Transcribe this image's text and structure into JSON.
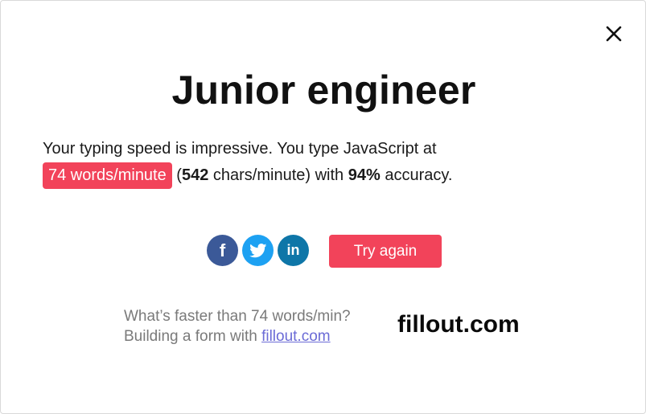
{
  "modal": {
    "title": "Junior engineer",
    "close_icon": "close-icon"
  },
  "result": {
    "intro": "Your typing speed is impressive. You type JavaScript at",
    "wpm_pill": "74 words/minute",
    "open_paren": " (",
    "chars": "542",
    "chars_suffix": " chars/minute) with ",
    "accuracy": "94%",
    "accuracy_suffix": " accuracy."
  },
  "share": {
    "facebook_glyph": "f",
    "linkedin_glyph": "in",
    "icons": [
      "facebook-icon",
      "twitter-icon",
      "linkedin-icon"
    ]
  },
  "actions": {
    "try_again_label": "Try again"
  },
  "promo": {
    "line1": "What’s faster than 74 words/min?",
    "line2_prefix": "Building a form with ",
    "link_text": "fillout.com",
    "brand": "fillout.com"
  },
  "colors": {
    "accent": "#f2435a",
    "facebook": "#3b5998",
    "twitter": "#1da1f2",
    "linkedin": "#0e76a8",
    "link": "#6b6bd6",
    "muted_text": "#7a7a7a"
  }
}
